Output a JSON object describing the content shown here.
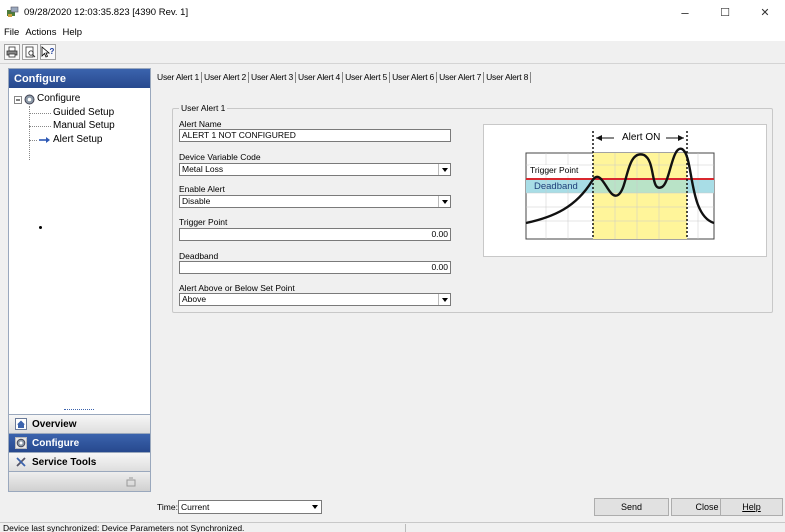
{
  "window": {
    "title": "09/28/2020 12:03:35.823 [4390 Rev. 1]",
    "controls": {
      "minimize": "–",
      "maximize": "☐",
      "close": "✕"
    }
  },
  "menu": [
    "File",
    "Actions",
    "Help"
  ],
  "toolbar": {
    "icons": [
      "print-icon",
      "print-preview-icon",
      "context-help-icon"
    ]
  },
  "left_panel": {
    "header": "Configure",
    "tree": {
      "root": "Configure",
      "children": [
        "Guided Setup",
        "Manual Setup",
        "Alert Setup"
      ]
    },
    "nav": {
      "overview": "Overview",
      "configure": "Configure",
      "service_tools": "Service Tools"
    }
  },
  "tabs": [
    "User Alert 1",
    "User Alert 2",
    "User Alert 3",
    "User Alert 4",
    "User Alert 5",
    "User Alert 6",
    "User Alert 7",
    "User Alert 8"
  ],
  "form": {
    "group_title": "User Alert 1",
    "alert_name": {
      "label": "Alert Name",
      "value": "ALERT 1 NOT CONFIGURED"
    },
    "device_variable_code": {
      "label": "Device Variable Code",
      "value": "Metal Loss"
    },
    "enable_alert": {
      "label": "Enable Alert",
      "value": "Disable"
    },
    "trigger_point": {
      "label": "Trigger Point",
      "value": "0.00"
    },
    "deadband": {
      "label": "Deadband",
      "value": "0.00"
    },
    "alert_above_below": {
      "label": "Alert Above or Below Set Point",
      "value": "Above"
    }
  },
  "diagram": {
    "alert_on": "Alert ON",
    "trigger_point": "Trigger Point",
    "deadband": "Deadband",
    "colors": {
      "alert_zone": "#fff59a",
      "deadband": "#a8dde6",
      "trigger_line": "#d9272e"
    }
  },
  "bottom": {
    "time_label": "Time:",
    "time_value": "Current",
    "send": "Send",
    "close": "Close",
    "help": "Help"
  },
  "status": {
    "text": "Device last synchronized: Device Parameters not Synchronized."
  }
}
